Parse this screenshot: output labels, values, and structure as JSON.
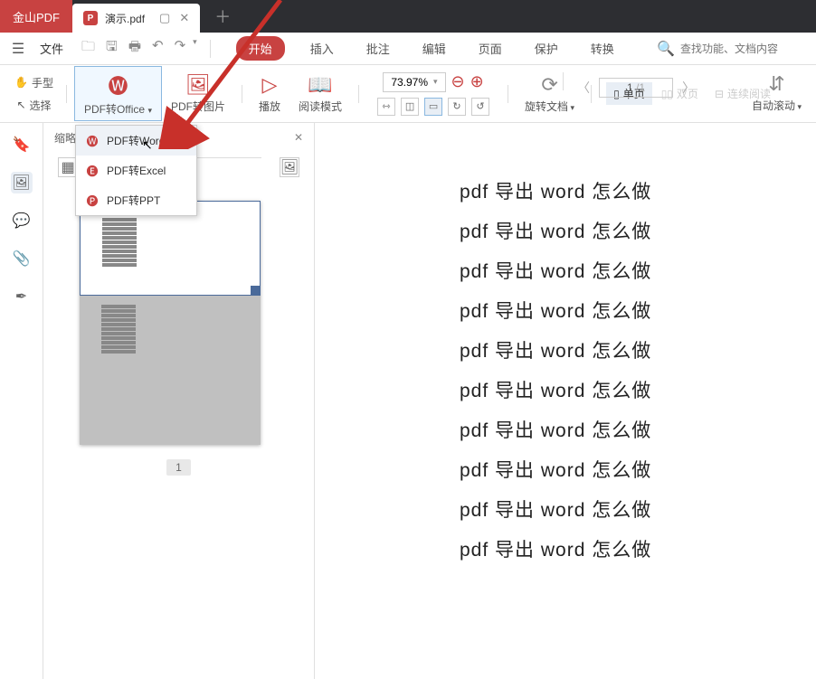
{
  "app_name": "金山PDF",
  "tab": {
    "title": "演示.pdf",
    "icon_letter": "P"
  },
  "menubar": {
    "file_label": "文件",
    "tabs": [
      "开始",
      "插入",
      "批注",
      "编辑",
      "页面",
      "保护",
      "转换"
    ],
    "search_placeholder": "查找功能、文档内容"
  },
  "toolbar": {
    "hand": "手型",
    "select": "选择",
    "pdf_to_office": "PDF转Office",
    "pdf_to_image": "PDF转图片",
    "play": "播放",
    "read_mode": "阅读模式",
    "zoom_value": "73.97%",
    "rotate": "旋转文档",
    "single_page": "单页",
    "double_page": "双页",
    "continuous": "连续阅读",
    "auto_scroll": "自动滚动",
    "page_current": "1",
    "page_sep": "/",
    "page_total": "1"
  },
  "dropdown": {
    "items": [
      {
        "label": "PDF转Word"
      },
      {
        "label": "PDF转Excel"
      },
      {
        "label": "PDF转PPT"
      }
    ]
  },
  "thumbnail": {
    "title_prefix": "缩略",
    "page_number": "1"
  },
  "document": {
    "lines": [
      "pdf 导出 word 怎么做",
      "pdf 导出 word 怎么做",
      "pdf 导出 word 怎么做",
      "pdf 导出 word 怎么做",
      "pdf 导出 word 怎么做",
      "pdf 导出 word 怎么做",
      "pdf 导出 word 怎么做",
      "pdf 导出 word 怎么做",
      "pdf 导出 word 怎么做",
      "pdf 导出 word 怎么做"
    ]
  }
}
